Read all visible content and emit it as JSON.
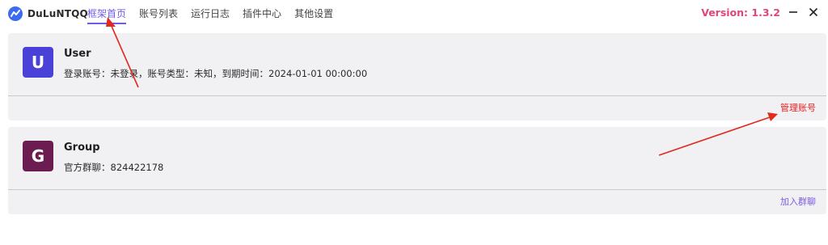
{
  "app": {
    "name": "DuLuNTQQ",
    "version": "Version: 1.3.2"
  },
  "nav": {
    "items": [
      "框架首页",
      "账号列表",
      "运行日志",
      "插件中心",
      "其他设置"
    ],
    "active_index": 0
  },
  "window": {
    "minimize": "−",
    "close": "×"
  },
  "user_card": {
    "avatar_letter": "U",
    "avatar_color": "#4a41d8",
    "title": "User",
    "info": "登录账号：未登录，账号类型：未知，到期时间：2024-01-01 00:00:00",
    "action": "管理账号",
    "action_color": "#e52020"
  },
  "group_card": {
    "avatar_letter": "G",
    "avatar_color": "#6b1d52",
    "title": "Group",
    "info": "官方群聊：824422178",
    "action": "加入群聊",
    "action_color": "#7b5ce0"
  },
  "colors": {
    "accent": "#6e5ce8",
    "version": "#e0467a",
    "annotation_arrow": "#e02a1e"
  }
}
